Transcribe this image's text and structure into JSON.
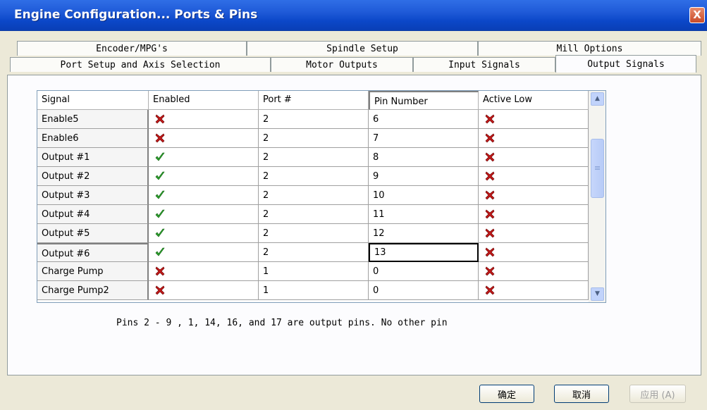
{
  "window": {
    "title": "Engine Configuration... Ports & Pins",
    "close_label": "X"
  },
  "tabs_row1": [
    {
      "label": "Encoder/MPG's"
    },
    {
      "label": "Spindle Setup"
    },
    {
      "label": "Mill Options"
    }
  ],
  "tabs_row2": [
    {
      "label": "Port Setup and Axis Selection"
    },
    {
      "label": "Motor Outputs"
    },
    {
      "label": "Input Signals"
    },
    {
      "label": "Output Signals",
      "active": true
    }
  ],
  "grid": {
    "columns": [
      "Signal",
      "Enabled",
      "Port #",
      "Pin Number",
      "Active Low"
    ],
    "rows": [
      {
        "signal": "Enable5",
        "enabled": false,
        "port": "2",
        "pin": "6",
        "active_low": false
      },
      {
        "signal": "Enable6",
        "enabled": false,
        "port": "2",
        "pin": "7",
        "active_low": false
      },
      {
        "signal": "Output #1",
        "enabled": true,
        "port": "2",
        "pin": "8",
        "active_low": false
      },
      {
        "signal": "Output #2",
        "enabled": true,
        "port": "2",
        "pin": "9",
        "active_low": false
      },
      {
        "signal": "Output #3",
        "enabled": true,
        "port": "2",
        "pin": "10",
        "active_low": false
      },
      {
        "signal": "Output #4",
        "enabled": true,
        "port": "2",
        "pin": "11",
        "active_low": false
      },
      {
        "signal": "Output #5",
        "enabled": true,
        "port": "2",
        "pin": "12",
        "active_low": false
      },
      {
        "signal": "Output #6",
        "enabled": true,
        "port": "2",
        "pin": "13",
        "active_low": false
      },
      {
        "signal": "Charge Pump",
        "enabled": false,
        "port": "1",
        "pin": "0",
        "active_low": false
      },
      {
        "signal": "Charge Pump2",
        "enabled": false,
        "port": "1",
        "pin": "0",
        "active_low": false
      }
    ],
    "icons": {
      "enabled_true": "green-check-icon",
      "enabled_false": "red-x-icon"
    },
    "colors": {
      "check": "#2ea52e",
      "x": "#c01818"
    }
  },
  "info_text": "Pins 2 - 9 , 1, 14, 16, and 17 are output pins. No  other pin",
  "buttons": {
    "ok": "确定",
    "cancel": "取消",
    "apply": "应用 (A)"
  }
}
